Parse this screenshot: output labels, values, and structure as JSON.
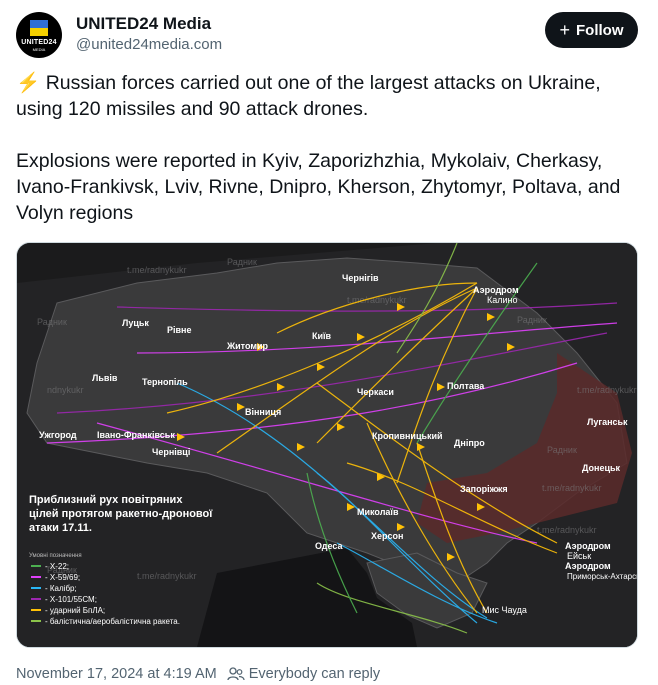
{
  "author": {
    "display_name": "UNITED24 Media",
    "handle": "@united24media.com",
    "avatar_text": "UNITED24",
    "avatar_subtext": "MEDIA"
  },
  "follow_label": "Follow",
  "post": {
    "emoji": "⚡",
    "line1": " Russian forces carried out one of the largest attacks on Ukraine, using 120 missiles and 90 attack drones.",
    "line2": "Explosions were reported in Kyiv, Zaporizhzhia, Mykolaiv, Cherkasy, Ivano-Frankivsk, Lviv, Rivne, Dnipro, Kherson, Zhytomyr, Poltava, and Volyn regions"
  },
  "map": {
    "watermark": "Радник t.me/radnykukr",
    "title_line1": "Приблизний рух повітряних",
    "title_line2": "цілей протягом ракетно-дронової",
    "title_line3": "атаки 17.11.",
    "legend_heading": "Умовні позначення",
    "legend": [
      {
        "label": "- X-22;",
        "color": "#4caf50"
      },
      {
        "label": "- X-59/69;",
        "color": "#e040fb"
      },
      {
        "label": "- Калібр;",
        "color": "#29b6f6"
      },
      {
        "label": "- X-101/55СМ;",
        "color": "#9c27b0"
      },
      {
        "label": "- ударний БпЛА;",
        "color": "#ffc107"
      },
      {
        "label": "- балістична/аеробалістична ракета.",
        "color": "#8bc34a"
      }
    ],
    "cities": {
      "kyiv": "Київ",
      "chernihiv": "Чернігів",
      "lutsk": "Луцьк",
      "rivne": "Рівне",
      "zhytomyr": "Житомир",
      "lviv": "Львів",
      "ternopil": "Тернопіль",
      "vinnytsia": "Вінниця",
      "uzhhorod": "Ужгород",
      "ivano": "Івано-Франківськ",
      "chernivtsi": "Чернівці",
      "cherkasy": "Черкаси",
      "poltava": "Полтава",
      "kropyvnytskyi": "Кропивницький",
      "dnipro": "Дніпро",
      "zaporizhzhia": "Запоріжжя",
      "mykolaiv": "Миколаїв",
      "kherson": "Херсон",
      "odesa": "Одеса",
      "luhansk": "Луганськ",
      "donetsk": "Донецьк"
    },
    "airfields": {
      "kalino_title": "Аэродром",
      "kalino_name": "Калино",
      "yeysk_title": "Аэродром",
      "yeysk_name": "Ейськ",
      "primorsk_title": "Аэродром",
      "primorsk_name": "Приморськ-Ахтарськ",
      "cape": "Мис Чауда"
    }
  },
  "footer": {
    "timestamp": "November 17, 2024 at 4:19 AM",
    "reply_setting": "Everybody can reply"
  }
}
